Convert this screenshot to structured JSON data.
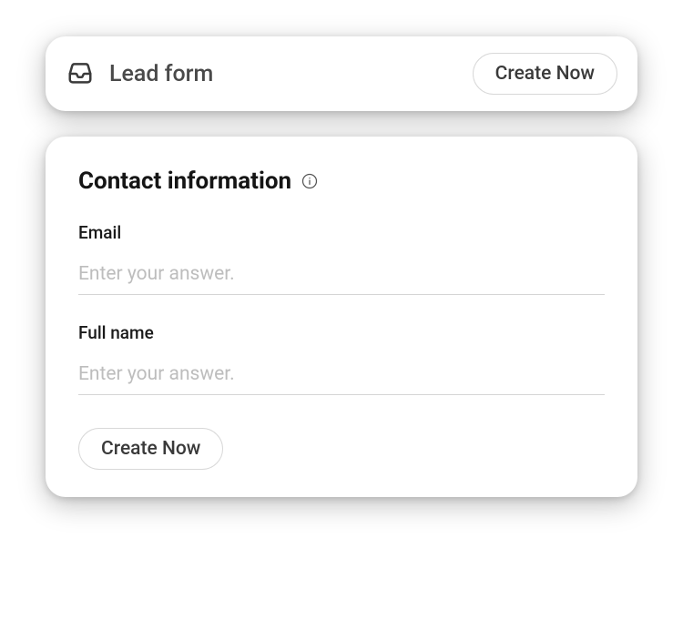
{
  "header": {
    "title": "Lead form",
    "create_button": "Create Now"
  },
  "form": {
    "heading": "Contact information",
    "fields": [
      {
        "label": "Email",
        "placeholder": "Enter your answer."
      },
      {
        "label": "Full name",
        "placeholder": "Enter your answer."
      }
    ],
    "submit_button": "Create Now"
  }
}
